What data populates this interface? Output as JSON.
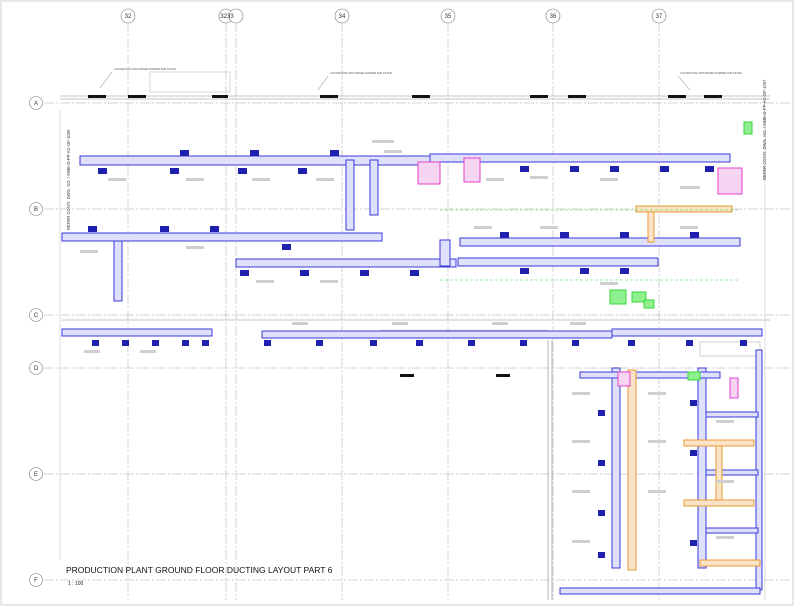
{
  "drawing": {
    "title": "PRODUCTION PLANT GROUND FLOOR DUCTING LAYOUT PART 6",
    "scale": "1 : 100",
    "refer_left": "REFER CONTI. DWG. NO. / MME-D-PP-AC-GF-1005",
    "refer_right": "REFER CONTI. DWG. NO. / MME-D-PP-AC-GF-1007"
  },
  "grid": {
    "columns": [
      "32",
      "32",
      "33",
      "34",
      "35",
      "36",
      "37"
    ],
    "rows": [
      "A",
      "B",
      "C",
      "D",
      "E",
      "F"
    ]
  },
  "notes": {
    "louver_a": "LOUVER WITH MOTORISED DAMPER AND FILTER",
    "louver_b": "LOUVER WITH MOTORISED DAMPER AND FILTER",
    "louver_c": "LOUVER WITH MOTORISED DAMPER AND FILTER"
  },
  "colors": {
    "supply_duct": "#3a3ad8",
    "return_duct": "#e89a3a",
    "exhaust_duct": "#e040c8",
    "equipment": "#39d639",
    "grid_line": "#9a9a9a",
    "text": "#333333"
  }
}
